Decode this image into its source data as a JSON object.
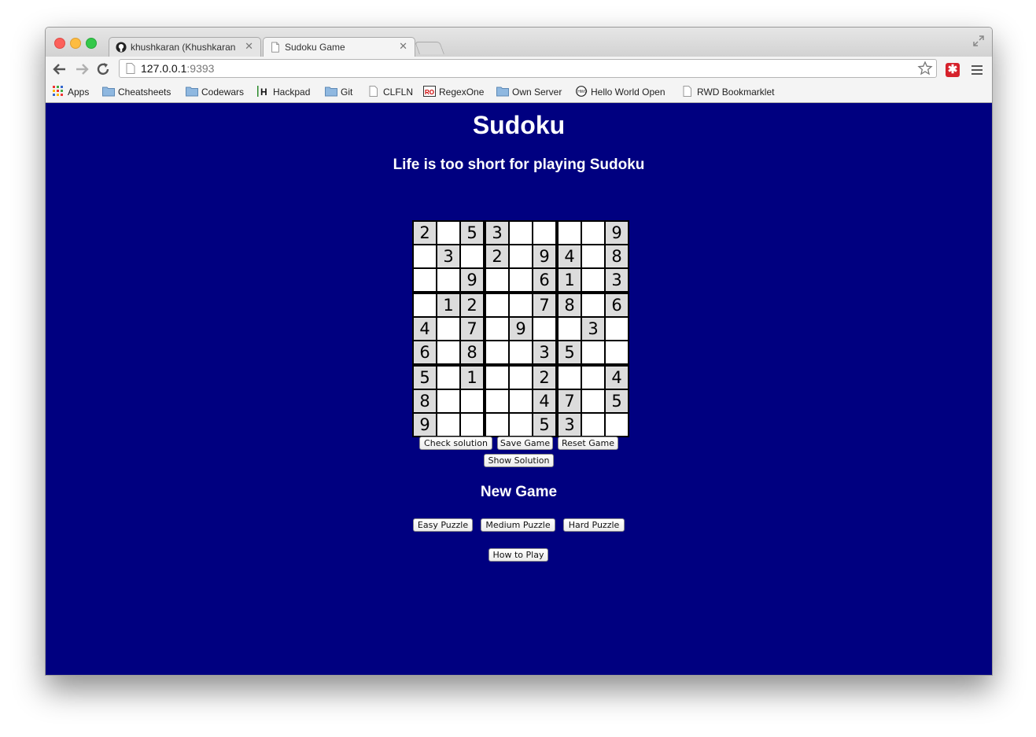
{
  "browser": {
    "tabs": [
      {
        "title": "khushkaran (Khushkaran S",
        "icon": "github-icon",
        "active": false
      },
      {
        "title": "Sudoku Game",
        "icon": "page-icon",
        "active": true
      }
    ],
    "url_host": "127.0.0.1",
    "url_port": ":9393",
    "bookmarks": [
      {
        "label": "Apps",
        "icon": "apps-grid-icon"
      },
      {
        "label": "Cheatsheets",
        "icon": "folder-icon"
      },
      {
        "label": "Codewars",
        "icon": "folder-icon"
      },
      {
        "label": "Hackpad",
        "icon": "hackpad-icon"
      },
      {
        "label": "Git",
        "icon": "folder-icon"
      },
      {
        "label": "CLFLN",
        "icon": "page-icon"
      },
      {
        "label": "RegexOne",
        "icon": "regexone-icon"
      },
      {
        "label": "Own Server",
        "icon": "folder-icon"
      },
      {
        "label": "Hello World Open",
        "icon": "hwo-icon"
      },
      {
        "label": "RWD Bookmarklet",
        "icon": "page-icon"
      }
    ]
  },
  "page": {
    "title": "Sudoku",
    "subtitle": "Life is too short for playing Sudoku",
    "grid": [
      [
        "2",
        "",
        "5",
        "3",
        "",
        "",
        "",
        "",
        "9"
      ],
      [
        "",
        "3",
        "",
        "2",
        "",
        "9",
        "4",
        "",
        "8"
      ],
      [
        "",
        "",
        "9",
        "",
        "",
        "6",
        "1",
        "",
        "3"
      ],
      [
        "",
        "1",
        "2",
        "",
        "",
        "7",
        "8",
        "",
        "6"
      ],
      [
        "4",
        "",
        "7",
        "",
        "9",
        "",
        "",
        "3",
        ""
      ],
      [
        "6",
        "",
        "8",
        "",
        "",
        "3",
        "5",
        "",
        ""
      ],
      [
        "5",
        "",
        "1",
        "",
        "",
        "2",
        "",
        "",
        "4"
      ],
      [
        "8",
        "",
        "",
        "",
        "",
        "4",
        "7",
        "",
        "5"
      ],
      [
        "9",
        "",
        "",
        "",
        "",
        "5",
        "3",
        "",
        ""
      ]
    ],
    "buttons": {
      "check": "Check solution",
      "save": "Save Game",
      "reset": "Reset Game",
      "show_solution": "Show Solution"
    },
    "new_game_heading": "New Game",
    "puzzle_buttons": {
      "easy": "Easy Puzzle",
      "medium": "Medium Puzzle",
      "hard": "Hard Puzzle"
    },
    "how_to_play": "How to Play"
  },
  "colors": {
    "page_background": "#000080",
    "given_cell": "#dcdcdc",
    "empty_cell": "#ffffff"
  }
}
